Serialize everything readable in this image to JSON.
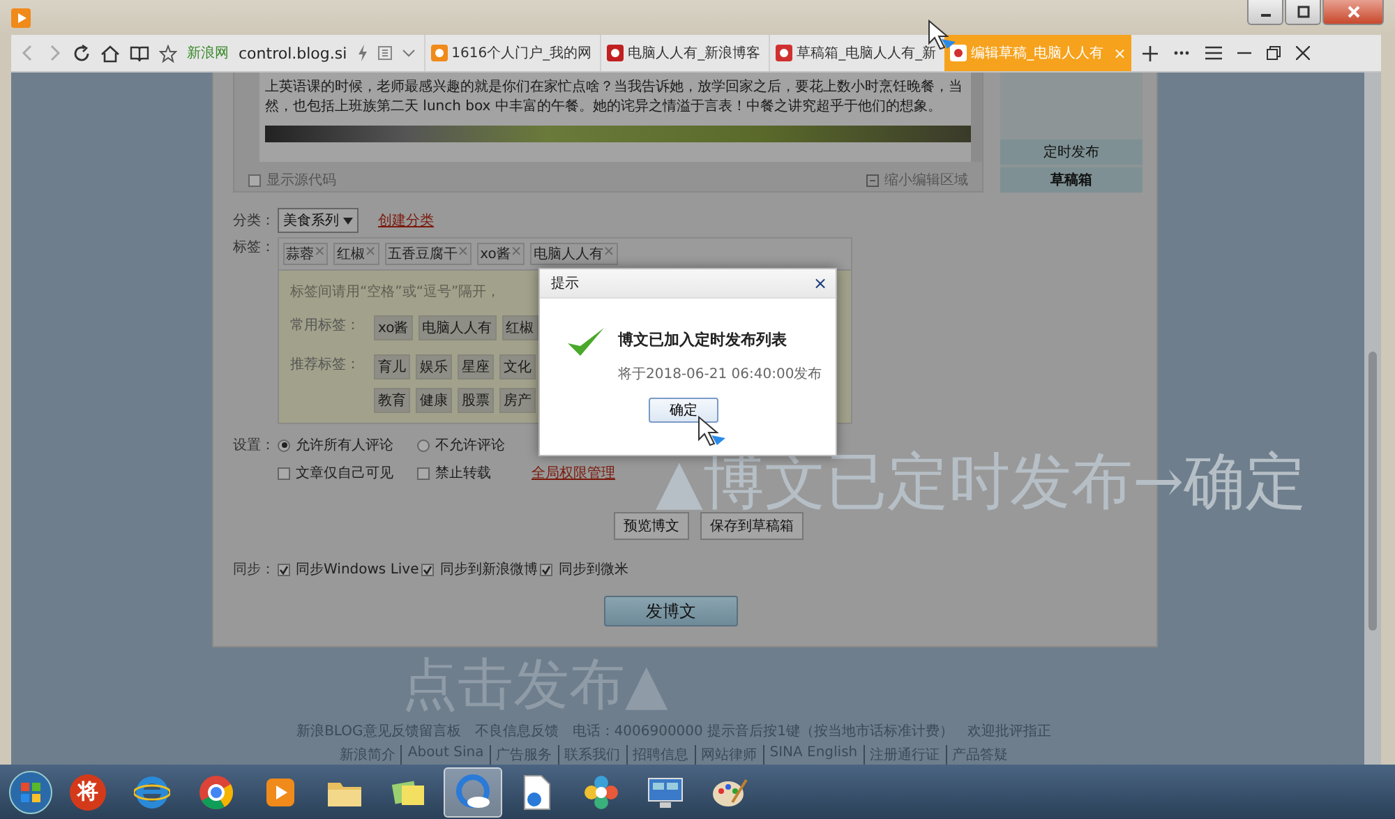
{
  "browser": {
    "site_label": "新浪网",
    "address": "control.blog.si",
    "tabs": [
      {
        "title": "1616个人门户_我的网",
        "selected": false
      },
      {
        "title": "电脑人人有_新浪博客",
        "selected": false
      },
      {
        "title": "草稿箱_电脑人人有_新",
        "selected": false
      },
      {
        "title": "编辑草稿_电脑人人有",
        "selected": true
      }
    ],
    "tab_close": "×"
  },
  "editor": {
    "text": "上英语课的时候，老师最感兴趣的就是你们在家忙点啥？当我告诉她，放学回家之后，要花上数小时烹饪晚餐，当然，也包括上班族第二天 lunch box 中丰富的午餐。她的诧异之情溢于言表！中餐之讲究超乎于他们的想象。",
    "show_source": {
      "label": "显示源代码",
      "checked": false
    },
    "shrink_label": "缩小编辑区域"
  },
  "side_buttons": [
    "定时发布",
    "草稿箱"
  ],
  "category": {
    "label": "分类：",
    "value": "美食系列",
    "link": "创建分类"
  },
  "tags": {
    "label": "标签：",
    "remove_mark": "×",
    "items": [
      "蒜蓉",
      "红椒",
      "五香豆腐干",
      "xo酱",
      "电脑人人有"
    ],
    "hint": "标签间请用“空格”或“逗号”隔开，",
    "common_label": "常用标签：",
    "common": [
      "xo酱",
      "电脑人人有",
      "红椒"
    ],
    "recommended_label": "推荐标签：",
    "recommended": [
      [
        "育儿",
        "娱乐",
        "星座",
        "文化"
      ],
      [
        "教育",
        "健康",
        "股票",
        "房产"
      ]
    ]
  },
  "settings": {
    "label": "设置：",
    "comments": [
      {
        "label": "允许所有人评论",
        "selected": true
      },
      {
        "label": "不允许评论",
        "selected": false
      }
    ],
    "options": [
      {
        "label": "文章仅自己可见",
        "checked": false
      },
      {
        "label": "禁止转载",
        "checked": false
      }
    ],
    "link": "全局权限管理"
  },
  "actions": [
    "预览博文",
    "保存到草稿箱"
  ],
  "sync": {
    "label": "同步：",
    "items": [
      {
        "label": "同步Windows Live",
        "checked": true
      },
      {
        "label": "同步到新浪微博",
        "checked": true
      },
      {
        "label": "同步到微米",
        "checked": true
      }
    ]
  },
  "publish": "发博文",
  "dialog": {
    "title": "提示",
    "close": "×",
    "message": "博文已加入定时发布列表",
    "detail": "将于2018-06-21 06:40:00发布",
    "button": "确定"
  },
  "annotation_top": "▲博文已定时发布→确定",
  "annotation_bottom": "点击发布▲",
  "footer": {
    "line": [
      "新浪BLOG意见反馈留言板",
      "不良信息反馈",
      "电话：4006900000 提示音后按1键（按当地市话标准计费）",
      "欢迎批评指正"
    ],
    "links": [
      "新浪简介",
      "About Sina",
      "广告服务",
      "联系我们",
      "招聘信息",
      "网站律师",
      "SINA English",
      "注册通行证",
      "产品答疑"
    ]
  },
  "taskbar": [
    {
      "kind": "glyph",
      "label": "将",
      "selected": false
    },
    {
      "kind": "ie",
      "selected": false
    },
    {
      "kind": "chrome",
      "selected": false
    },
    {
      "kind": "player",
      "selected": false
    },
    {
      "kind": "folder",
      "selected": false
    },
    {
      "kind": "notes",
      "selected": false
    },
    {
      "kind": "browser",
      "selected": true
    },
    {
      "kind": "document",
      "selected": false
    },
    {
      "kind": "flower",
      "selected": false
    },
    {
      "kind": "remote",
      "selected": false
    },
    {
      "kind": "paint",
      "selected": false
    }
  ]
}
